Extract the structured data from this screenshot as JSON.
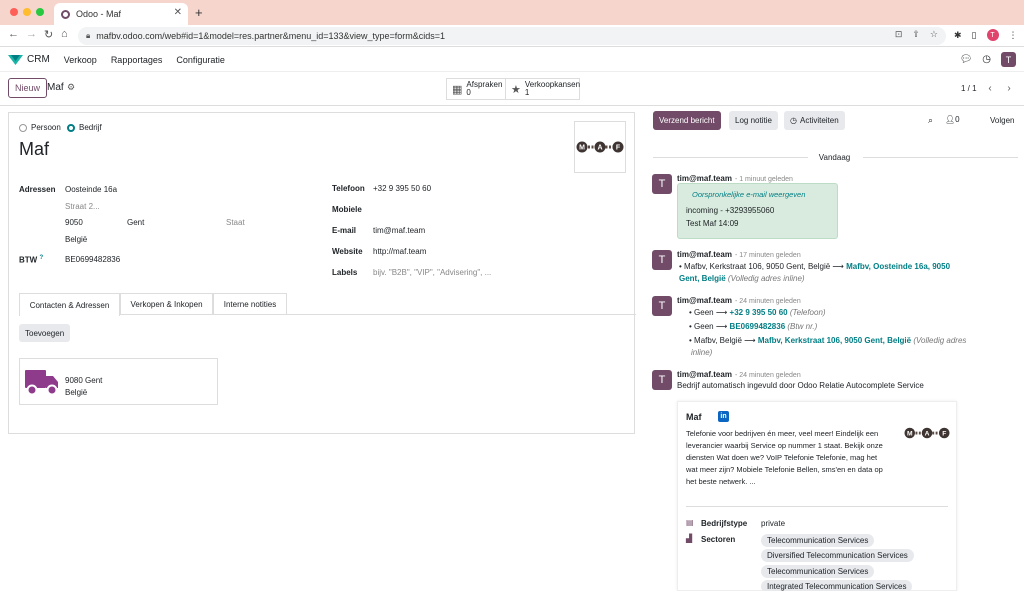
{
  "browser": {
    "tab_title": "Odoo - Maf",
    "url": "mafbv.odoo.com/web#id=1&model=res.partner&menu_id=133&view_type=form&cids=1",
    "profile_initial": "T"
  },
  "navbar": {
    "app": "CRM",
    "menus": [
      "Verkoop",
      "Rapportages",
      "Configuratie"
    ],
    "user_initial": "T"
  },
  "control": {
    "new_label": "Nieuw",
    "record_title": "Maf",
    "smart_buttons": [
      {
        "label": "Afspraken",
        "count": "0",
        "icon": "calendar-icon"
      },
      {
        "label": "Verkoopkansen",
        "count": "1",
        "icon": "star-icon"
      }
    ],
    "pager": "1 / 1"
  },
  "form": {
    "radio_person": "Persoon",
    "radio_company": "Bedrijf",
    "name": "Maf",
    "logo_letters": [
      "M",
      "A",
      "F"
    ],
    "address_label": "Adressen",
    "street": "Oosteinde 16a",
    "street2_placeholder": "Straat 2...",
    "zip": "9050",
    "city": "Gent",
    "state_placeholder": "Staat",
    "country": "België",
    "vat_label": "BTW",
    "vat_help": "?",
    "vat": "BE0699482836",
    "phone_label": "Telefoon",
    "phone": "+32 9 395 50 60",
    "mobile_label": "Mobiele",
    "email_label": "E-mail",
    "email": "tim@maf.team",
    "website_label": "Website",
    "website": "http://maf.team",
    "tags_label": "Labels",
    "tags_placeholder": "bijv. \"B2B\", \"VIP\", \"Advisering\", ...",
    "tabs": [
      "Contacten & Adressen",
      "Verkopen & Inkopen",
      "Interne notities"
    ],
    "add_label": "Toevoegen",
    "contact_card": {
      "line1": "9080 Gent",
      "line2": "België"
    }
  },
  "chatter": {
    "send_label": "Verzend bericht",
    "note_label": "Log notitie",
    "activities_label": "Activiteiten",
    "attachments": "0",
    "follow_label": "Volgen",
    "today": "Vandaag",
    "messages": [
      {
        "initial": "T",
        "author": "tim@maf.team",
        "time": "- 1 minuut geleden",
        "email_link": "Oorspronkelijke e-mail weergeven",
        "body1": "incoming - +3293955060",
        "body2": "Test Maf 14:09"
      },
      {
        "initial": "T",
        "author": "tim@maf.team",
        "time": "- 17 minuten geleden",
        "old": "Mafbv, Kerkstraat 106, 9050 Gent, België",
        "new_a": "Mafbv, Oosteinde 16a, 9050",
        "new_b": "Gent, België",
        "field": "(Volledig adres inline)"
      },
      {
        "initial": "T",
        "author": "tim@maf.team",
        "time": "- 24 minuten geleden",
        "changes": [
          {
            "old": "Geen",
            "new": "+32 9 395 50 60",
            "field": "(Telefoon)"
          },
          {
            "old": "Geen",
            "new": "BE0699482836",
            "field": "(Btw nr.)"
          },
          {
            "old": "Mafbv, België",
            "new": "Mafbv, Kerkstraat 106, 9050 Gent, België",
            "field_a": "(Volledig adres",
            "field_b": "inline)"
          }
        ]
      },
      {
        "initial": "T",
        "author": "tim@maf.team",
        "time": "- 24 minuten geleden",
        "body": "Bedrijf automatisch ingevuld door Odoo Relatie Autocomplete Service"
      }
    ],
    "preview": {
      "name": "Maf",
      "linkedin": "in",
      "desc": [
        "Telefonie voor bedrijven én meer, veel meer! Eindelijk een",
        "leverancier waarbij Service op nummer 1 staat. Bekijk onze",
        "diensten Wat doen we? VoIP Telefonie Telefonie, mag het",
        "wat meer zijn? Mobiele Telefonie Bellen, sms'en en data op",
        "het beste netwerk. ..."
      ],
      "type_label": "Bedrijfstype",
      "type_value": "private",
      "sectors_label": "Sectoren",
      "sectors": [
        "Telecommunication Services",
        "Diversified Telecommunication Services",
        "Telecommunication Services",
        "Integrated Telecommunication Services"
      ]
    }
  },
  "colors": {
    "brand": "#714b67",
    "teal": "#017e84"
  }
}
